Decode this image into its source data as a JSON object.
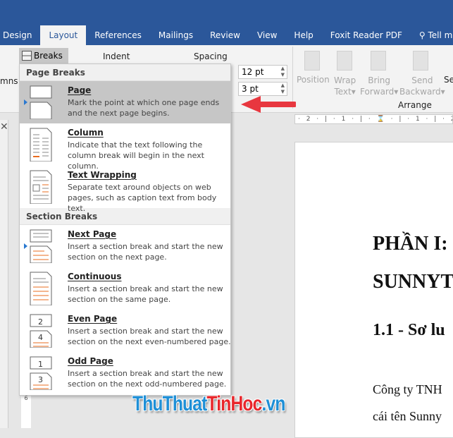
{
  "colors": {
    "title_bar": "#2b579a",
    "highlight": "#c6c6c6",
    "accent_orange": "#e86c1f",
    "arrow_red": "#e8373f",
    "watermark_blue": "#1e8fd6",
    "watermark_red": "#e8262b"
  },
  "tabs": [
    {
      "label": "Design"
    },
    {
      "label": "Layout",
      "active": true
    },
    {
      "label": "References"
    },
    {
      "label": "Mailings"
    },
    {
      "label": "Review"
    },
    {
      "label": "View"
    },
    {
      "label": "Help"
    },
    {
      "label": "Foxit Reader PDF"
    }
  ],
  "tell_me": {
    "icon": "search-icon",
    "label": "Tell me w"
  },
  "ribbon": {
    "breaks_label": "Breaks",
    "columns_partial": "mns",
    "indent_label": "Indent",
    "spacing_label": "Spacing",
    "spacing_before": "12 pt",
    "spacing_after": "3 pt",
    "position": "Position",
    "wrap_text": [
      "Wrap",
      "Text"
    ],
    "bring_forward": [
      "Bring",
      "Forward"
    ],
    "send_backward": [
      "Send",
      "Backward"
    ],
    "selection_partial": "Se",
    "arrange_label": "Arrange"
  },
  "ruler": {
    "marks": "· 2 · | · 1 · | · ⌛ · | · 1 · | · 2 ·"
  },
  "vruler": {
    "marks": "6"
  },
  "menu": {
    "page_breaks_header": "Page Breaks",
    "page_breaks": [
      {
        "title": "Page",
        "desc": "Mark the point at which one page ends and the next page begins.",
        "selected": true
      },
      {
        "title": "Column",
        "desc": "Indicate that the text following the column break will begin in the next column."
      },
      {
        "title": "Text Wrapping",
        "desc": "Separate text around objects on web pages, such as caption text from body text."
      }
    ],
    "section_breaks_header": "Section Breaks",
    "section_breaks": [
      {
        "title": "Next Page",
        "desc": "Insert a section break and start the new section on the next page."
      },
      {
        "title": "Continuous",
        "desc": "Insert a section break and start the new section on the same page."
      },
      {
        "title": "Even Page",
        "desc": "Insert a section break and start the new section on the next even-numbered page.",
        "nums": [
          "2",
          "4"
        ]
      },
      {
        "title": "Odd Page",
        "desc": "Insert a section break and start the new section on the next odd-numbered page.",
        "nums": [
          "1",
          "3"
        ]
      }
    ]
  },
  "document": {
    "heading1a": "PHẦN I:",
    "heading1b": "SUNNYT",
    "heading2": "1.1 - Sơ lu",
    "body1": "Công ty TNH",
    "body2": "cái tên Sunny"
  },
  "watermark": {
    "part1": "ThuThuat",
    "part2": "TinHoc",
    ".vn": ".vn"
  }
}
